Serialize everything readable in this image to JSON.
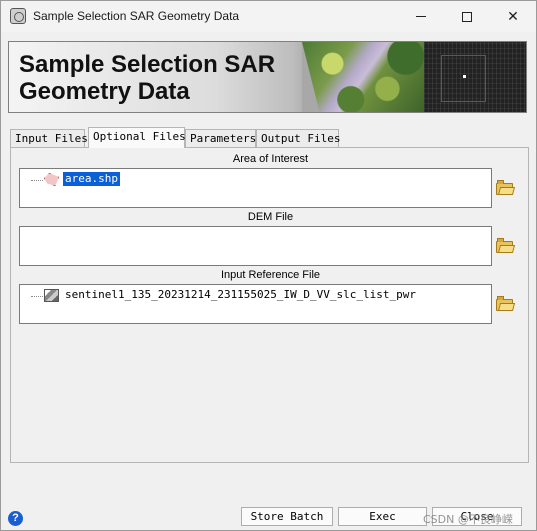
{
  "window": {
    "title": "Sample Selection SAR Geometry Data",
    "icon": "app-icon"
  },
  "banner": {
    "title": "Sample Selection SAR\nGeometry Data"
  },
  "tabs": [
    {
      "label": "Input Files",
      "active": false
    },
    {
      "label": "Optional Files",
      "active": true
    },
    {
      "label": "Parameters",
      "active": false
    },
    {
      "label": "Output Files",
      "active": false
    }
  ],
  "sections": [
    {
      "label": "Area of Interest",
      "item": "area.shp",
      "icon": "shapefile-icon",
      "selected": true
    },
    {
      "label": "DEM File",
      "item": "",
      "icon": "",
      "selected": false
    },
    {
      "label": "Input Reference File",
      "item": "sentinel1_135_20231214_231155025_IW_D_VV_slc_list_pwr",
      "icon": "raster-icon",
      "selected": false
    }
  ],
  "buttons": {
    "store_batch": "Store Batch",
    "exec": "Exec",
    "close": "Close"
  },
  "help_label": "?",
  "watermark": "CSDN @不良峥嵘",
  "colors": {
    "selection": "#0b5fd7",
    "sar_box": "#e02020"
  }
}
